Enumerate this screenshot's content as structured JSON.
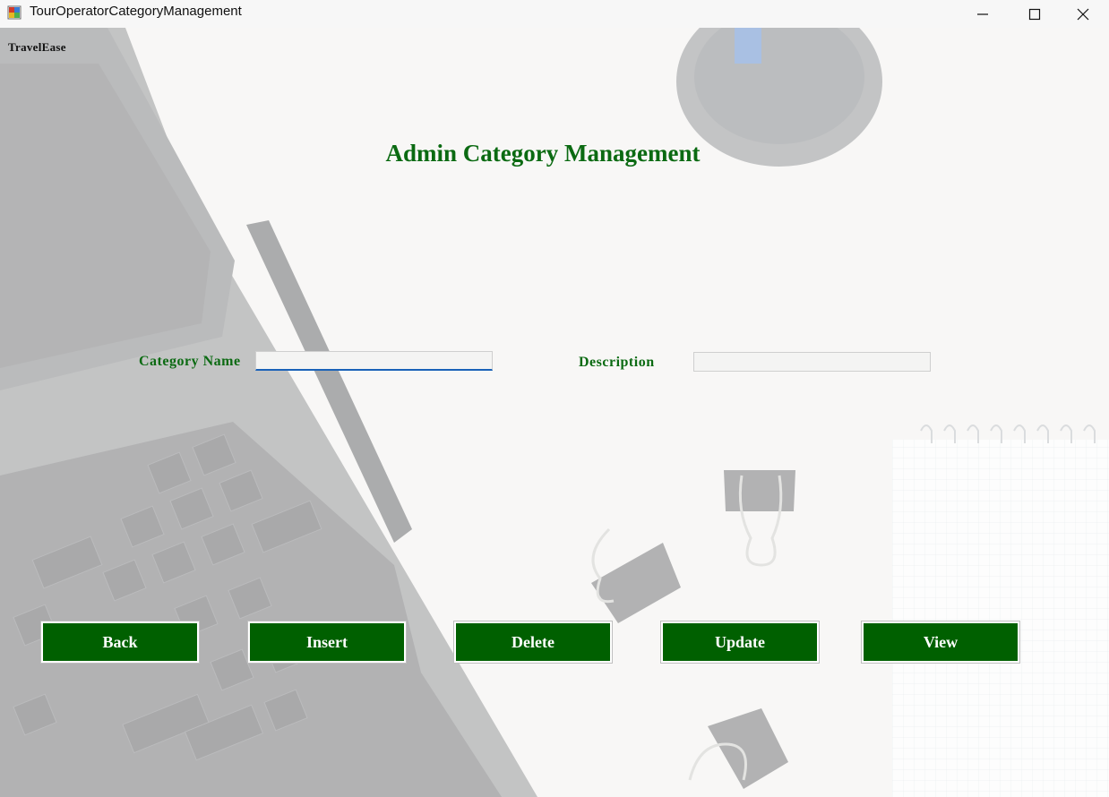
{
  "window": {
    "title": "TourOperatorCategoryManagement"
  },
  "brand": "TravelEase",
  "heading": "Admin Category Management",
  "form": {
    "category_name_label": "Category Name",
    "category_name_value": "",
    "description_label": "Description",
    "description_value": ""
  },
  "buttons": {
    "back": "Back",
    "insert": "Insert",
    "delete": "Delete",
    "update": "Update",
    "view": "View"
  },
  "colors": {
    "accent": "#006000",
    "label": "#0b6a12",
    "focus": "#1a62b8"
  },
  "icons": [
    "app-icon",
    "minimize-icon",
    "maximize-icon",
    "close-icon"
  ]
}
